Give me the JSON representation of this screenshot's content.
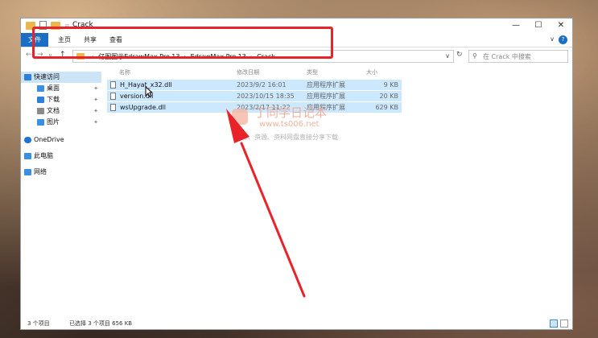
{
  "window": {
    "title": "Crack",
    "controls": [
      "—",
      "☐",
      "✕"
    ]
  },
  "ribbon": {
    "tabs": [
      "文件",
      "主页",
      "共享",
      "查看"
    ],
    "help": "?"
  },
  "nav": {
    "back": "←",
    "forward": "→",
    "recent": "∨",
    "up": "↑"
  },
  "address": {
    "crumbs": [
      "亿图图示EdrawMax.Pro.13",
      "EdrawMax.Pro.13",
      "Crack"
    ],
    "dropdown": "∨",
    "refresh": "↻"
  },
  "search": {
    "placeholder": "在 Crack 中搜索"
  },
  "sidebar": {
    "items": [
      {
        "label": "快速访问",
        "icon": "star-icon",
        "color": "#2f7fd8"
      },
      {
        "label": "桌面",
        "icon": "desktop-icon",
        "color": "#3b8ee0",
        "pinned": true
      },
      {
        "label": "下载",
        "icon": "download-icon",
        "color": "#2f7fd8",
        "pinned": true
      },
      {
        "label": "文档",
        "icon": "document-icon",
        "color": "#8a8a8a",
        "pinned": true
      },
      {
        "label": "图片",
        "icon": "pictures-icon",
        "color": "#3b8ee0",
        "pinned": true
      },
      {
        "label": "OneDrive",
        "icon": "cloud-icon",
        "color": "#1f73d1"
      },
      {
        "label": "此电脑",
        "icon": "computer-icon",
        "color": "#3b8ee0"
      },
      {
        "label": "网络",
        "icon": "network-icon",
        "color": "#3b8ee0"
      }
    ],
    "pin_glyph": "📌"
  },
  "columns": [
    "名称",
    "修改日期",
    "类型",
    "大小"
  ],
  "files": [
    {
      "name": "H_Hayat_x32.dll",
      "date": "2023/9/2 16:01",
      "type": "应用程序扩展",
      "size": "9 KB"
    },
    {
      "name": "version.dll",
      "date": "2023/10/15 18:35",
      "type": "应用程序扩展",
      "size": "20 KB"
    },
    {
      "name": "wsUpgrade.dll",
      "date": "2023/2/17 11:22",
      "type": "应用程序扩展",
      "size": "629 KB"
    }
  ],
  "status": {
    "count": "3 个项目",
    "selected": "已选择 3 个项目  656 KB"
  },
  "watermark": {
    "title": "丁同学日记本",
    "url": "www.ts006.net",
    "subtitle": "软件、资源、资料网盘直接分享下载"
  },
  "colors": {
    "accent": "#1a6fc4",
    "annotation": "#e8242a",
    "selection": "#cce8ff"
  }
}
